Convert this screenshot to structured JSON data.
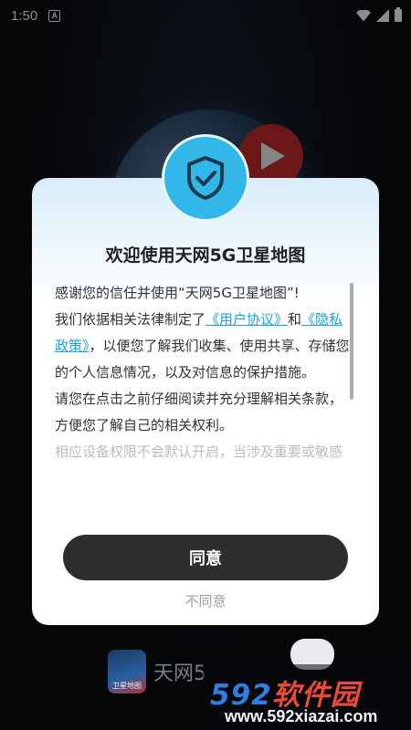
{
  "status_bar": {
    "time": "1:50",
    "notification_icon_letter": "A",
    "icons": [
      "wifi-icon",
      "signal-icon",
      "battery-icon"
    ]
  },
  "dialog": {
    "title": "欢迎使用天网5G卫星地图",
    "paragraphs": {
      "p1": "感谢您的信任并使用“天网5G卫星地图”!",
      "p2_prefix": "我们依据相关法律制定了",
      "link_user_agreement": "《用户协议》",
      "p2_and": "和",
      "link_privacy_policy": "《隐私政策》",
      "p2_suffix": "，以便您了解我们收集、使用共享、存储您的个人信息情况，以及对信息的保护措施。",
      "p3": "请您在点击之前仔细阅读并充分理解相关条款，方便您了解自己的相关权利。",
      "p4": "相应设备权限不会默认开启，当涉及重要或敏感"
    },
    "agree_label": "同意",
    "disagree_label": "不同意",
    "colors": {
      "link": "#1aa1e6",
      "badge": "#33b7e9",
      "agree_button": "#2d2e30"
    }
  },
  "branding": {
    "app_name_partial": "天网5",
    "logo_text": "卫星地图",
    "watermark_main_a": "592",
    "watermark_main_b": "软件园",
    "watermark_url": "www.592xiazai.com"
  }
}
